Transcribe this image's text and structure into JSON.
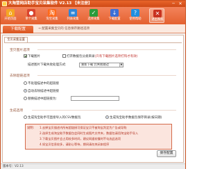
{
  "window": {
    "title": "大淘营网店助手宝贝采集软件 V2.13 【未注册】",
    "minimize": "─",
    "close": "✕"
  },
  "toolbar": [
    {
      "label": "开始页面",
      "icon": "home-icon",
      "color": "#f5a623",
      "glyph": "⌂"
    },
    {
      "label": "单个采集",
      "icon": "pin-icon",
      "color": "#d9442e",
      "glyph": "●"
    },
    {
      "label": "淘宝采集",
      "icon": "taobao-icon",
      "color": "#ff6a1a",
      "glyph": "淘"
    },
    {
      "label": "列表采集",
      "icon": "list-icon",
      "color": "#2e86d9",
      "glyph": "≡"
    },
    {
      "label": "选择采集",
      "icon": "select-icon",
      "color": "#2b9b3b",
      "glyph": "✓"
    },
    {
      "label": "下载配置",
      "icon": "download-icon",
      "color": "#3b6fd6",
      "glyph": "↓"
    },
    {
      "label": "使用帮助",
      "icon": "help-icon",
      "color": "#1f8fe0",
      "glyph": "?"
    },
    {
      "label": "退出系统",
      "icon": "exit-icon",
      "color": "#c8321f",
      "glyph": "✕"
    }
  ],
  "nav": {
    "tab": "下载配置",
    "hint": "→ 配置采集宝贝的 信息保存路径选项"
  },
  "panel": {
    "subtab": "宝贝采集设置",
    "image_section": {
      "title": "宝贝图片选项",
      "download_images": "下载图片",
      "open_folder": "打开数据包分类目录",
      "open_folder_note": "(只有下载图片选项打钩才有效)",
      "image_size_label": "描述图片下载失败处理方式:",
      "image_size_value": "重新下载 仍失败跳过",
      "dropdown_arrow": "▼"
    },
    "cleanup_section": {
      "title": "去除超链选项",
      "opt1": "不处理描述中的超链接",
      "opt2": "自动去除描述中超链接",
      "opt3": "替换描述中超链接为:"
    },
    "gen_section": {
      "title": "生成选项",
      "opt_csv": "生成淘宝助手可直接导入的CSV数据包",
      "opt_folder": "生成淘宝助手数据包保存目录(按日期)",
      "notes_label": "说明:",
      "notes": [
        "1.去掉宝贝描述内所有超链接可保证宝贝不被淘宝判定为广告或导购",
        "2.选择生成淘宝助手数据包会同时生成图片文件夹，数据包请用淘宝助手导入",
        "3.下载宝贝图片会占用较多时间，建议网速较慢时不勾选此选项",
        "4.如宝贝信息较多，请耐心等待，期间请勿关闭本程序"
      ]
    },
    "save": "保存配置"
  },
  "status": {
    "text": "版本号：V2.13"
  }
}
